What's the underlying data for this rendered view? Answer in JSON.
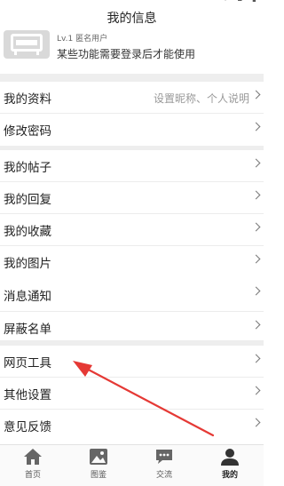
{
  "header": {
    "title": "我的信息"
  },
  "profile": {
    "level": "Lv.1 匿名用户",
    "notice": "某些功能需要登录后才能使用"
  },
  "menu": {
    "profile": {
      "label": "我的资料",
      "hint": "设置昵称、个人说明"
    },
    "password": {
      "label": "修改密码"
    },
    "posts": {
      "label": "我的帖子"
    },
    "replies": {
      "label": "我的回复"
    },
    "favorites": {
      "label": "我的收藏"
    },
    "pictures": {
      "label": "我的图片"
    },
    "notifications": {
      "label": "消息通知"
    },
    "blocklist": {
      "label": "屏蔽名单"
    },
    "webtools": {
      "label": "网页工具"
    },
    "settings": {
      "label": "其他设置"
    },
    "feedback": {
      "label": "意见反馈"
    }
  },
  "tabbar": {
    "home": {
      "label": "首页",
      "icon": "home-icon"
    },
    "gallery": {
      "label": "图鉴",
      "icon": "image-icon"
    },
    "chat": {
      "label": "交流",
      "icon": "chat-bubble-icon"
    },
    "me": {
      "label": "我的",
      "icon": "person-icon"
    }
  },
  "colors": {
    "annotation_arrow": "#e53935",
    "separator": "#eeeeee",
    "active_tab": "#333333"
  }
}
